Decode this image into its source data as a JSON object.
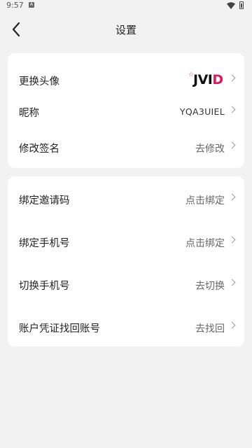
{
  "status_bar": {
    "time": "9:57",
    "notification_badge": "A"
  },
  "header": {
    "title": "设置"
  },
  "profile_section": {
    "avatar": {
      "label": "更换头像",
      "logo_text": "JVI",
      "logo_text_accent": "D",
      "logo_star": "☆"
    },
    "nickname": {
      "label": "昵称",
      "value": "YQA3UIEL"
    },
    "signature": {
      "label": "修改签名",
      "value": "去修改"
    }
  },
  "account_section": {
    "invite_code": {
      "label": "绑定邀请码",
      "value": "点击绑定"
    },
    "bind_phone": {
      "label": "绑定手机号",
      "value": "点击绑定"
    },
    "switch_phone": {
      "label": "切换手机号",
      "value": "去切换"
    },
    "recover_account": {
      "label": "账户凭证找回账号",
      "value": "去找回"
    }
  },
  "colors": {
    "background": "#f2f2f2",
    "card": "#ffffff",
    "brand_accent": "#e0185f"
  }
}
